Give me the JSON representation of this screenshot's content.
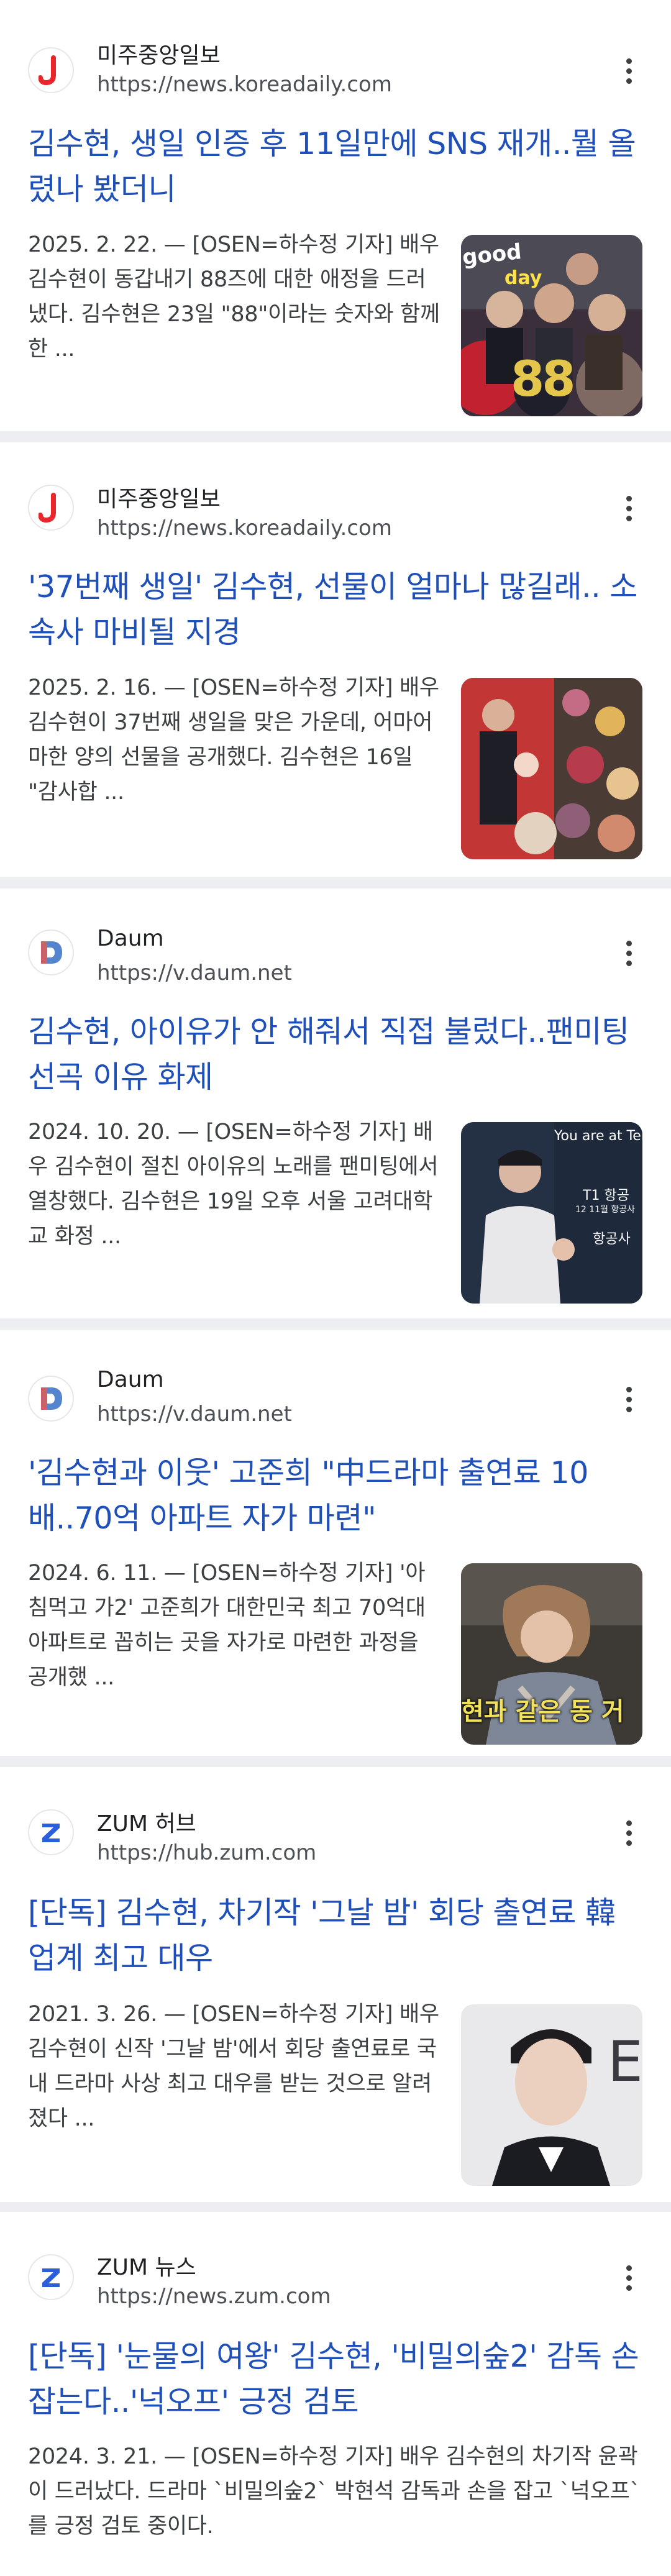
{
  "results": [
    {
      "source": "미주중앙일보",
      "url": "https://news.koreadaily.com",
      "logo": "koreadaily-logo",
      "title": "김수현, 생일 인증 후 11일만에 SNS 재개..뭘 올렸나 봤더니",
      "snippet": "2025. 2. 22. — [OSEN=하수정 기자] 배우 김수현이 동갑내기 88즈에 대한 애정을 드러냈다. 김수현은 23일 \"88\"이라는 숫자와 함께 한 ...",
      "thumb_text": [
        "good",
        "day",
        "88"
      ]
    },
    {
      "source": "미주중앙일보",
      "url": "https://news.koreadaily.com",
      "logo": "koreadaily-logo",
      "title": "'37번째 생일' 김수현, 선물이 얼마나 많길래.. 소속사 마비될 지경",
      "snippet": "2025. 2. 16. — [OSEN=하수정 기자] 배우 김수현이 37번째 생일을 맞은 가운데, 어마어마한 양의 선물을 공개했다. 김수현은 16일 \"감사합 ...",
      "thumb_text": []
    },
    {
      "source": "Daum",
      "url": "https://v.daum.net",
      "logo": "daum-logo",
      "title": "김수현, 아이유가 안 해줘서 직접 불렀다..팬미팅 선곡 이유 화제",
      "snippet": "2024. 10. 20. — [OSEN=하수정 기자] 배우 김수현이 절친 아이유의 노래를 팬미팅에서 열창했다. 김수현은 19일 오후 서울 고려대학교 화정 ...",
      "thumb_text": [
        "You are at Ter",
        "T1 항공",
        "12 11월 항공사",
        "항공사"
      ]
    },
    {
      "source": "Daum",
      "url": "https://v.daum.net",
      "logo": "daum-logo",
      "title": "'김수현과 이웃' 고준희 \"中드라마 출연료 10배..70억 아파트 자가 마련\"",
      "snippet": "2024. 6. 11. — [OSEN=하수정 기자] '아침먹고 가2' 고준희가 대한민국 최고 70억대 아파트로 꼽히는 곳을 자가로 마련한 과정을 공개했 ...",
      "thumb_text": [
        "현과 같은 동 거"
      ]
    },
    {
      "source": "ZUM 허브",
      "url": "https://hub.zum.com",
      "logo": "zum-logo",
      "title": "[단독] 김수현, 차기작 '그날 밤' 회당 출연료 韓업계 최고 대우",
      "snippet": "2021. 3. 26. — [OSEN=하수정 기자] 배우 김수현이 신작 '그날 밤'에서 회당 출연료로 국내 드라마 사상 최고 대우를 받는 것으로 알려졌다 ...",
      "thumb_text": [
        "E"
      ]
    },
    {
      "source": "ZUM 뉴스",
      "url": "https://news.zum.com",
      "logo": "zum-logo",
      "title": "[단독] '눈물의 여왕' 김수현, '비밀의숲2' 감독 손잡는다..'넉오프' 긍정 검토",
      "snippet": "2024. 3. 21. — [OSEN=하수정 기자] 배우 김수현의 차기작 윤곽이 드러났다. 드라마 `비밀의숲2` 박현석 감독과 손을 잡고 `넉오프`를 긍정 검토 중이다.",
      "thumb_text": []
    }
  ],
  "colors": {
    "title": "#1f4fb8",
    "page_bg": "#eceef1",
    "card_bg": "#ffffff"
  }
}
